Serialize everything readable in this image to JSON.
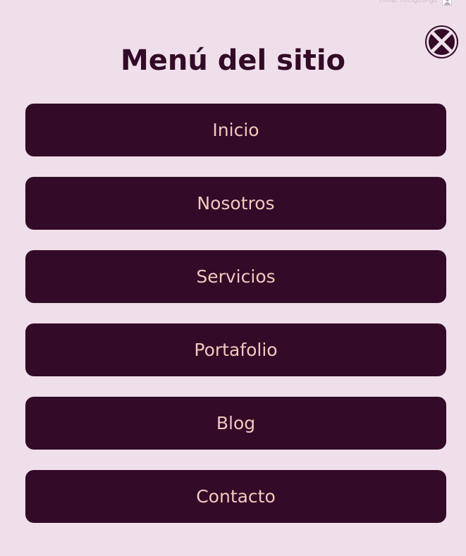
{
  "topbar": {
    "user_label": "Hola, recigeorge"
  },
  "menu_title": "Menú del sitio",
  "close_icon": "close-x-icon",
  "menu_items": [
    {
      "label": "Inicio"
    },
    {
      "label": "Nosotros"
    },
    {
      "label": "Servicios"
    },
    {
      "label": "Portafolio"
    },
    {
      "label": "Blog"
    },
    {
      "label": "Contacto"
    }
  ],
  "colors": {
    "background": "#efdfea",
    "accent_dark": "#330a28",
    "button_text": "#f2c9bd"
  }
}
